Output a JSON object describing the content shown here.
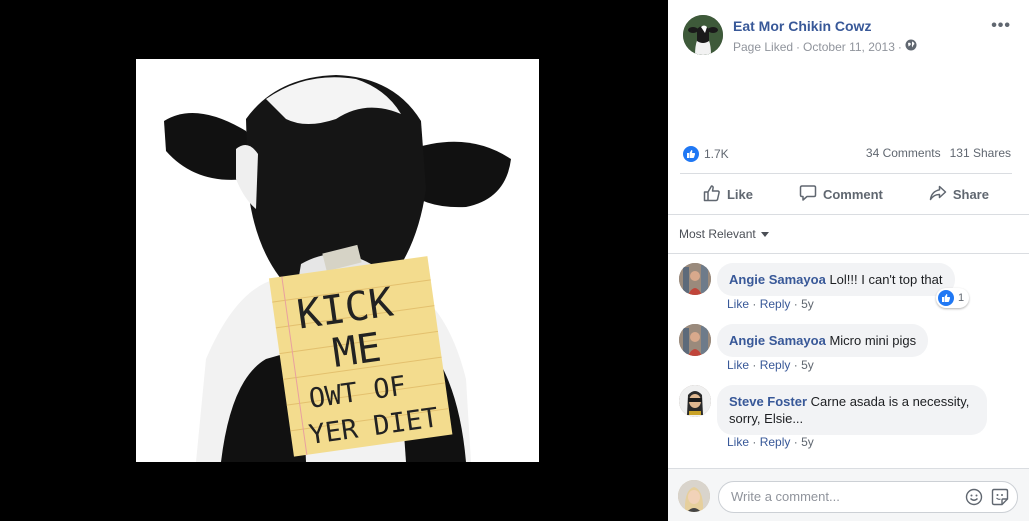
{
  "post": {
    "image": {
      "sign_lines": [
        "KICK",
        "ME",
        "OWT OF",
        "YER DIET"
      ]
    },
    "page": {
      "name": "Eat Mor Chikin Cowz",
      "action": "Page Liked",
      "sep1": "·",
      "date": "October 11, 2013",
      "sep2": "·",
      "more_label": "•••"
    },
    "stats": {
      "likes": "1.7K",
      "comments": "34 Comments",
      "shares": "131 Shares"
    },
    "actions": {
      "like": "Like",
      "comment": "Comment",
      "share": "Share"
    },
    "sort_label": "Most Relevant",
    "comments": [
      {
        "author": "Angie Samayoa",
        "text": "Lol!!! I can't top that",
        "like": "Like",
        "reply": "Reply",
        "sep": "·",
        "time": "5y",
        "reactions": "1"
      },
      {
        "author": "Angie Samayoa",
        "text": "Micro mini pigs",
        "like": "Like",
        "reply": "Reply",
        "sep": "·",
        "time": "5y"
      },
      {
        "author": "Steve Foster",
        "text": "Carne asada is a necessity, sorry, Elsie...",
        "like": "Like",
        "reply": "Reply",
        "sep": "·",
        "time": "5y"
      }
    ],
    "composer": {
      "placeholder": "Write a comment..."
    },
    "colors": {
      "link": "#385898",
      "like_blue": "#2078f4",
      "sign_paper": "#f3dc8e"
    }
  }
}
